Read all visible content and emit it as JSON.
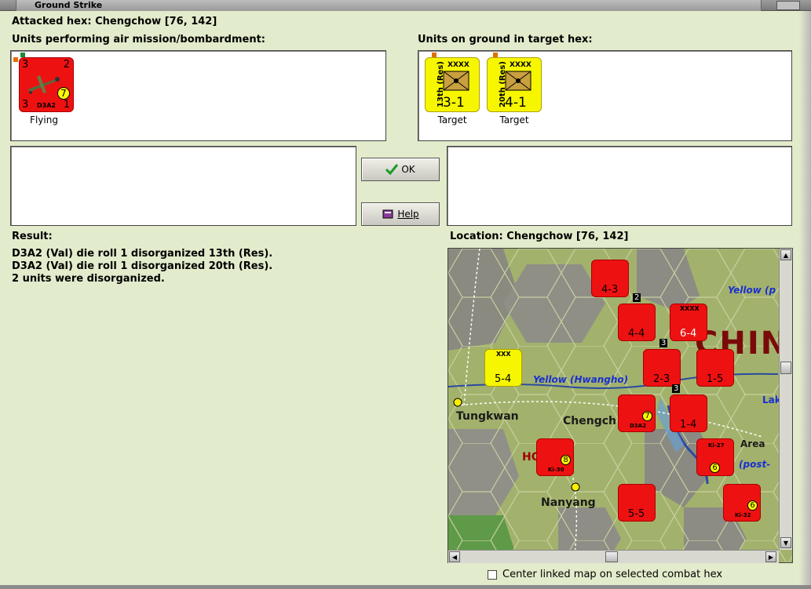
{
  "window": {
    "title": "Ground Strike"
  },
  "attacked_hex": "Attacked hex: Chengchow  [76, 142]",
  "air_units": {
    "label": "Units performing air mission/bombardment:",
    "items": [
      {
        "type": "D3A2",
        "top_left": "3",
        "top_right": "2",
        "bottom_left": "3",
        "bottom_right": "1",
        "badge": "7",
        "caption": "Flying",
        "icon": "dive-bomber-plane-icon"
      }
    ]
  },
  "ground_units": {
    "label": "Units on ground in target hex:",
    "items": [
      {
        "side_name": "13th (Res)",
        "size": "XXXX",
        "strength": "3-1",
        "caption": "Target",
        "icon": "infantry-symbol-icon"
      },
      {
        "side_name": "20th (Res)",
        "size": "XXXX",
        "strength": "4-1",
        "caption": "Target",
        "icon": "infantry-symbol-icon"
      }
    ]
  },
  "buttons": {
    "ok": "OK",
    "help": "Help"
  },
  "result": {
    "label": "Result:",
    "lines": [
      "D3A2 (Val) die roll 1 disorganized 13th (Res).",
      "D3A2 (Val) die roll 1 disorganized 20th (Res).",
      "2 units were disorganized."
    ]
  },
  "location": "Location:  Chengchow  [76, 142]",
  "map": {
    "place_names": [
      "Tungkwan",
      "Chengch",
      "Nanyang",
      "Area",
      "Lak",
      "HO"
    ],
    "river_labels": [
      "Yellow (Hwangho)",
      "Yellow (p",
      "(post-"
    ],
    "region_label": "CHIN",
    "counters": [
      {
        "strength": "4-3",
        "color": "red",
        "size": ""
      },
      {
        "strength": "4-4",
        "color": "red",
        "size": "2"
      },
      {
        "strength": "6-4",
        "color": "red",
        "size": "XXXX"
      },
      {
        "strength": "5-4",
        "color": "yellow",
        "size": "XXX"
      },
      {
        "strength": "2-3",
        "color": "red",
        "size": "3"
      },
      {
        "strength": "1-5",
        "color": "red",
        "size": ""
      },
      {
        "strength": "1-4",
        "color": "red",
        "size": "3"
      },
      {
        "strength": "5-5",
        "color": "red",
        "size": ""
      }
    ],
    "aircraft": [
      {
        "type": "D3A2",
        "badge": "7"
      },
      {
        "type": "Ki-30",
        "badge": "8"
      },
      {
        "type": "Ki-27",
        "badge": "6"
      },
      {
        "type": "Ki-32",
        "badge": "6"
      }
    ]
  },
  "center_option": "Center linked map on selected combat hex",
  "colors": {
    "background": "#e2ebcb",
    "unit_red": "#ee1111",
    "unit_yellow": "#f6f600",
    "river_label": "#1a2fd0"
  }
}
